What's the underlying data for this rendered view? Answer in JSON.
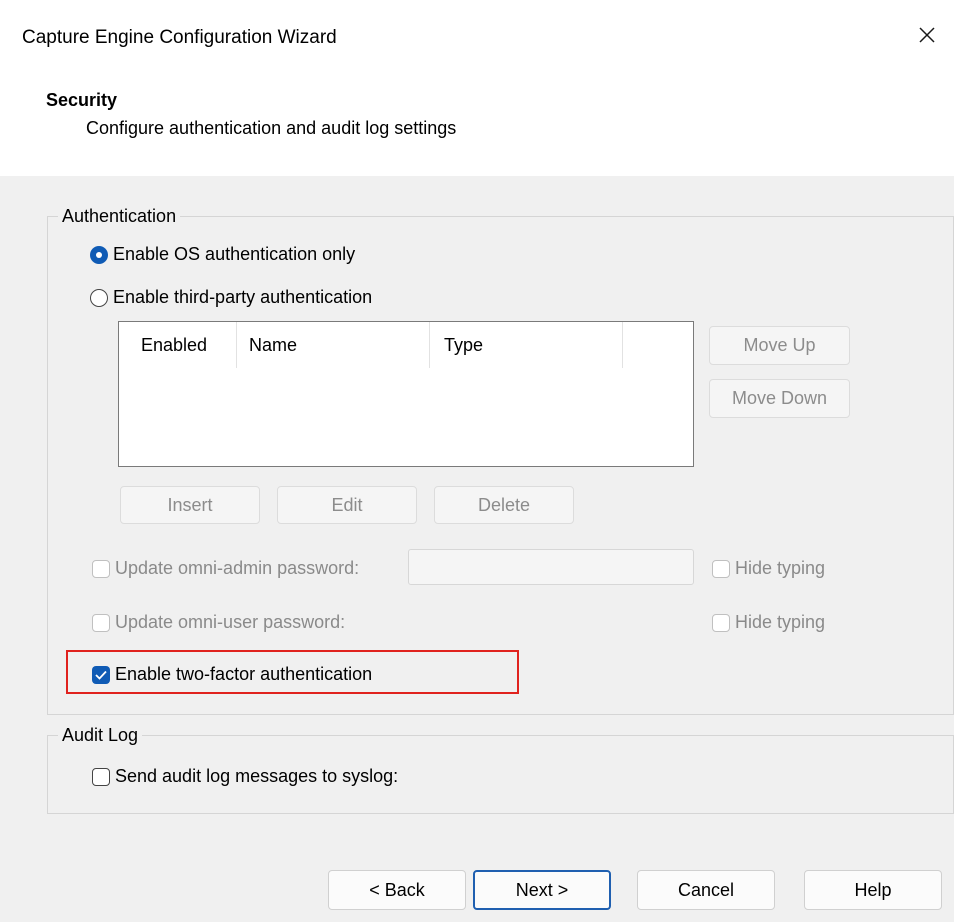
{
  "window": {
    "title": "Capture Engine Configuration Wizard"
  },
  "header": {
    "title": "Security",
    "subtitle": "Configure authentication and audit log settings"
  },
  "authentication": {
    "group_label": "Authentication",
    "os_only_label": "Enable OS authentication only",
    "os_only_selected": true,
    "third_party_label": "Enable third-party authentication",
    "third_party_selected": false,
    "list_columns": [
      "Enabled",
      "Name",
      "Type"
    ],
    "move_up_label": "Move Up",
    "move_down_label": "Move Down",
    "insert_label": "Insert",
    "edit_label": "Edit",
    "delete_label": "Delete",
    "admin_password_label": "Update omni-admin password:",
    "admin_password_value": "",
    "admin_hide_typing_label": "Hide typing",
    "user_password_label": "Update omni-user password:",
    "user_hide_typing_label": "Hide typing",
    "two_factor_label": "Enable two-factor authentication",
    "two_factor_checked": true
  },
  "audit_log": {
    "group_label": "Audit Log",
    "syslog_label": "Send audit log messages to syslog:",
    "syslog_checked": false
  },
  "footer": {
    "back_label": "< Back",
    "next_label": "Next >",
    "cancel_label": "Cancel",
    "help_label": "Help"
  },
  "colors": {
    "accent": "#0f5bb5",
    "highlight_border": "#e0221e",
    "dialog_body": "#f0f0f0"
  }
}
